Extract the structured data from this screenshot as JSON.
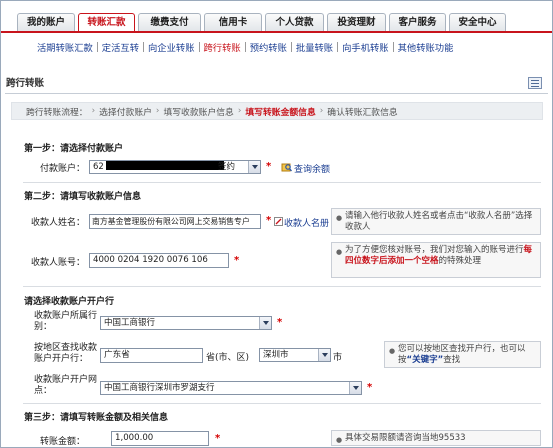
{
  "main_tabs": [
    {
      "label": "我的账户",
      "active": false
    },
    {
      "label": "转账汇款",
      "active": true
    },
    {
      "label": "缴费支付",
      "active": false
    },
    {
      "label": "信用卡",
      "active": false
    },
    {
      "label": "个人贷款",
      "active": false
    },
    {
      "label": "投资理财",
      "active": false
    },
    {
      "label": "客户服务",
      "active": false
    },
    {
      "label": "安全中心",
      "active": false
    }
  ],
  "sub_nav": [
    {
      "label": "活期转账汇款",
      "active": false
    },
    {
      "label": "定活互转",
      "active": false
    },
    {
      "label": "向企业转账",
      "active": false
    },
    {
      "label": "跨行转账",
      "active": true
    },
    {
      "label": "预约转账",
      "active": false
    },
    {
      "label": "批量转账",
      "active": false
    },
    {
      "label": "向手机转账",
      "active": false
    },
    {
      "label": "其他转账功能",
      "active": false
    }
  ],
  "page_title": "跨行转账",
  "flow": {
    "prefix": "跨行转账流程：",
    "steps": [
      "选择付款账户",
      "填写收款账户信息",
      "填写转账金额信息",
      "确认转账汇款信息"
    ],
    "current_index": 2,
    "arrow": "›"
  },
  "step1": {
    "title": "第一步：请选择付款账户",
    "payer_label": "付款账户：",
    "payer_prefix": "62",
    "payer_suffix": "签约",
    "balance_link": "查询余额"
  },
  "step2": {
    "title": "第二步：请填写收款账户信息",
    "name_label": "收款人姓名：",
    "name_value": "南方基金管理股份有限公司网上交易销售专户",
    "name_link": "收款人名册",
    "name_hint": "请输入他行收款人姓名或者点击“收款人名册”选择收款人",
    "acct_label": "收款人账号：",
    "acct_value": "4000 0204 1920 0076 106",
    "acct_hint_a": "为了方便您核对账号，我们对您输入的账号进行",
    "acct_hint_red": "每四位数字后添加一个空格",
    "acct_hint_b": "的特殊处理"
  },
  "bank": {
    "title": "请选择收款账户开户行",
    "type_label": "收款账户所属行别：",
    "type_value": "中国工商银行",
    "area_label": "按地区查找收款账户开户行：",
    "province_value": "广东省",
    "province_suffix": "省(市、区)",
    "city_value": "深圳市",
    "city_suffix": "市",
    "area_hint_a": "您可以按地区查找开户行，也可以按",
    "area_hint_key": "“关键字”",
    "area_hint_b": "查找",
    "branch_label": "收款账户开户网点：",
    "branch_value": "中国工商银行深圳市罗湖支行"
  },
  "step3": {
    "title": "第三步：请填写转账金额及相关信息",
    "amount_label": "转账金额：",
    "amount_value": "1,000.00",
    "amount_hint": "具体交易限额请咨询当地95533"
  },
  "required_mark": "*",
  "hint_dot": "●",
  "colors": {
    "brand_red": "#c8141c",
    "link_blue": "#1a3d91",
    "tab_bg": "#e2e6ea"
  }
}
